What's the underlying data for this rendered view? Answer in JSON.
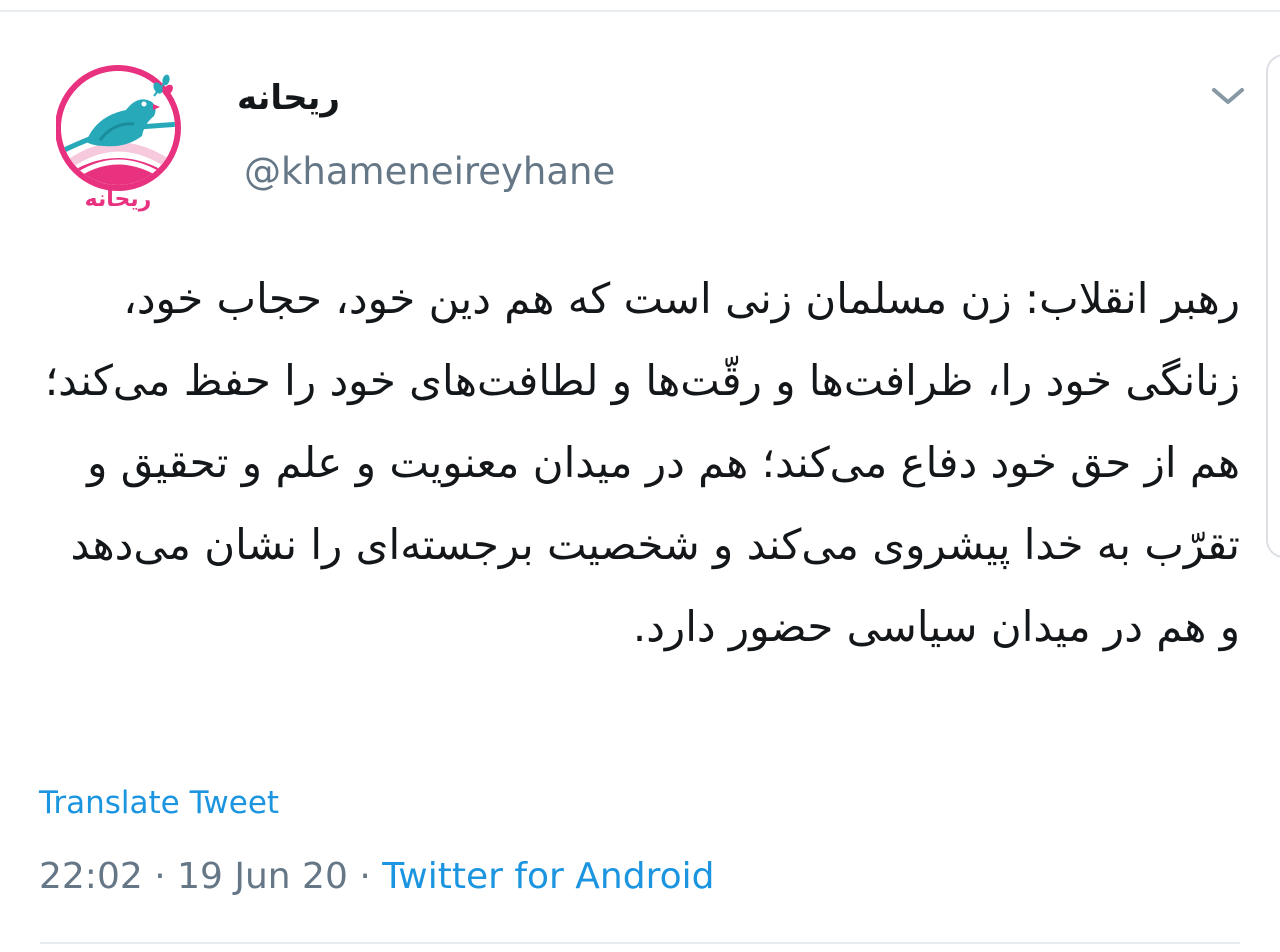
{
  "tweet": {
    "display_name": "ریحانه",
    "handle": "@khameneireyhane",
    "text": "رهبر انقلاب: زن مسلمان زنی است که هم دین خود، حجاب خود، زنانگی خود را، ظرافت‌ها و رقّت‌ها و لطافت‌های خود را حفظ می‌کند؛ هم از حق خود دفاع می‌کند؛ هم در میدان معنویت و علم و تحقیق و تقرّب به خدا پیشروی می‌کند و شخصیت برجسته‌ای را نشان می‌دهد و هم در میدان سیاسی حضور دارد.",
    "translate_label": "Translate Tweet",
    "time": "22:02",
    "separator": "·",
    "date": "19 Jun 20",
    "source": "Twitter for Android"
  },
  "avatar": {
    "logo_text": "ریحانه",
    "icon": "bird-on-branch-logo",
    "colors": {
      "ring": "#e8317f",
      "bird": "#27a9ba",
      "sky": "#f7c9dc"
    }
  },
  "icons": {
    "menu": "chevron-down-icon"
  },
  "colors": {
    "link": "#1b95e0",
    "secondary": "#657786",
    "primary_text": "#14171a"
  }
}
